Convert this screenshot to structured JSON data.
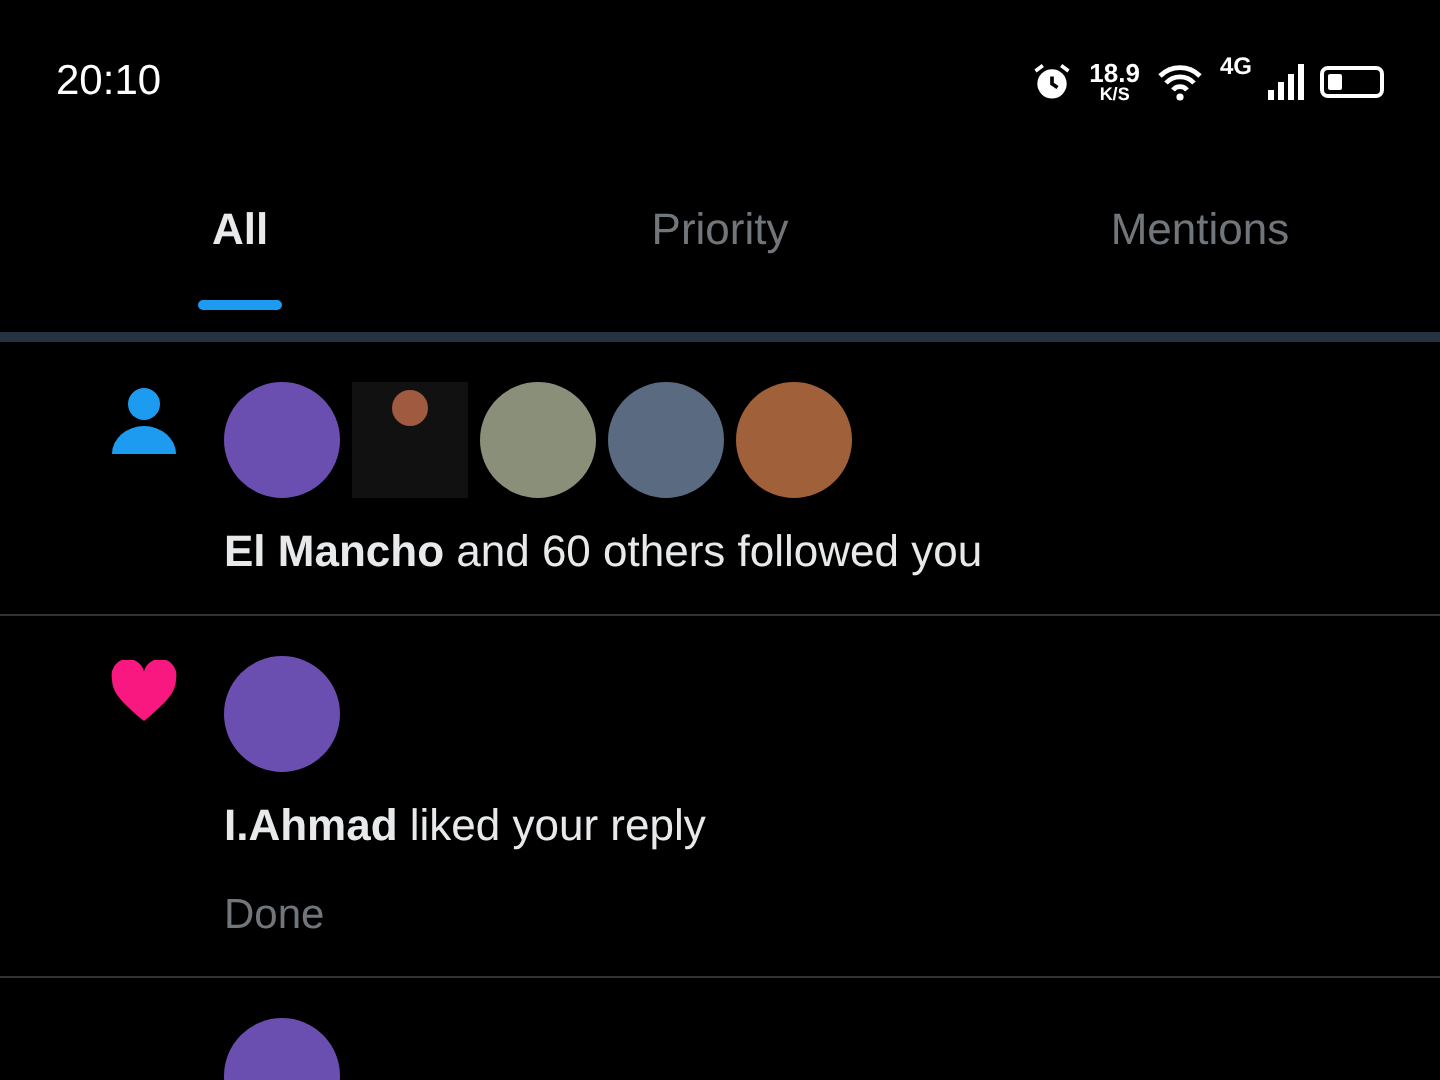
{
  "status_bar": {
    "time": "20:10",
    "speed": "18.9",
    "speed_unit": "K/S",
    "network": "4G"
  },
  "tabs": [
    {
      "label": "All",
      "selected": true
    },
    {
      "label": "Priority",
      "selected": false
    },
    {
      "label": "Mentions",
      "selected": false
    }
  ],
  "notifications": [
    {
      "kind": "follow",
      "avatars": [
        {
          "kind": "photo"
        },
        {
          "kind": "quote-image"
        },
        {
          "kind": "photo"
        },
        {
          "kind": "photo"
        },
        {
          "kind": "photo"
        }
      ],
      "text": "**El Mancho** and 60 others followed you"
    },
    {
      "kind": "like",
      "avatars": [
        {
          "kind": "photo"
        }
      ],
      "text": "**I.Ahmad** liked your reply",
      "detail": "Done"
    },
    {
      "kind": "partial",
      "avatars": [
        {
          "kind": "photo"
        }
      ]
    }
  ]
}
